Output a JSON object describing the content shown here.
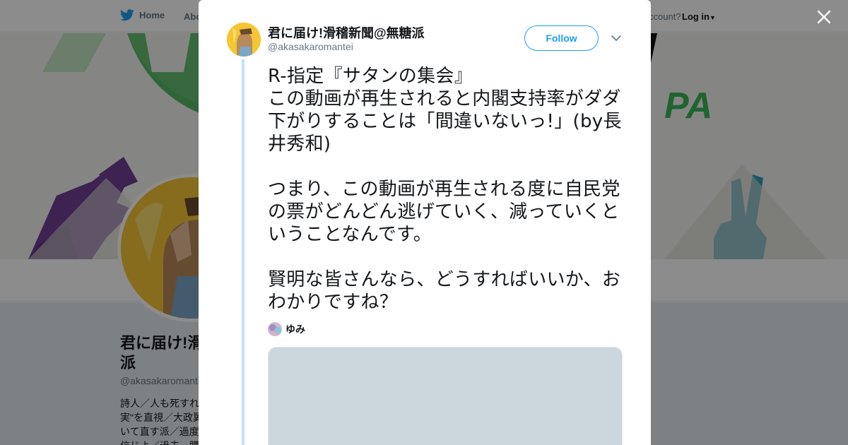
{
  "topnav": {
    "home_label": "Home",
    "about_label": "Abo",
    "account_prompt": "ccount?",
    "login_label": "Log in"
  },
  "banner": {
    "text": "PA"
  },
  "background_profile": {
    "name": "君に届け!滑\n派",
    "handle": "@akasakaromant",
    "bio": "詩人／人も死すれ\n実\"を直視／大政翼\nいて直す派／過度\n信じよ／過去、購"
  },
  "modal": {
    "author_name": "君に届け!滑稽新聞@無糖派",
    "author_handle": "@akasakaromantei",
    "follow_label": "Follow",
    "tweet_text": "R-指定『サタンの集会』\nこの動画が再生されると内閣支持率がダダ下がりすることは「間違いないっ!」(by長井秀和)\n\nつまり、この動画が再生される度に自民党の票がどんどん逃げていく、減っていくということなんです。\n\n賢明な皆さんなら、どうすればいいか、おわかりですね？",
    "reply_user": "ゆみ"
  },
  "colors": {
    "twitter_blue": "#1da1f2",
    "thread_line": "#bde3fb",
    "banner_green": "#58b867",
    "banner_purple": "#6f3f96",
    "banner_teal": "#2e9bb8",
    "avatar_yellow": "#f5c534"
  },
  "icons": {
    "brand": "twitter-bird-icon",
    "close": "close-icon",
    "menu": "chevron-down-icon"
  }
}
